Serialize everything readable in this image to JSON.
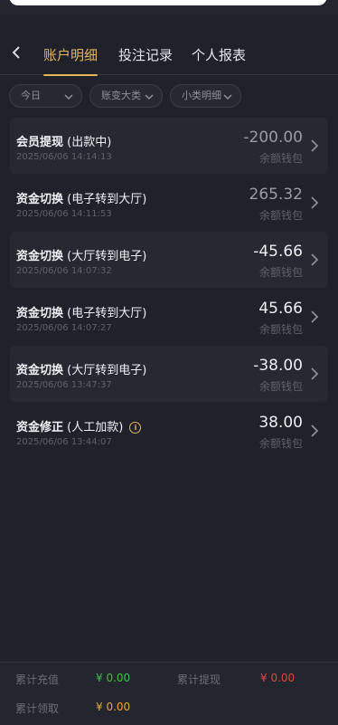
{
  "header": {
    "tabs": [
      {
        "label": "账户明细",
        "active": true
      },
      {
        "label": "投注记录",
        "active": false
      },
      {
        "label": "个人报表",
        "active": false
      }
    ]
  },
  "filters": [
    {
      "label": "今日"
    },
    {
      "label": "账变大类"
    },
    {
      "label": "小类明细"
    }
  ],
  "records": [
    {
      "title": "会员提现",
      "detail": "(出款中)",
      "time": "2025/06/06 14:14:13",
      "amount": "-200.00",
      "wallet": "余额钱包",
      "has_info": false
    },
    {
      "title": "资金切换",
      "detail": "(电子转到大厅)",
      "time": "2025/06/06 14:11:53",
      "amount": "265.32",
      "wallet": "余额钱包",
      "has_info": false
    },
    {
      "title": "资金切换",
      "detail": "(大厅转到电子)",
      "time": "2025/06/06 14:07:32",
      "amount": "-45.66",
      "wallet": "余额钱包",
      "has_info": false
    },
    {
      "title": "资金切换",
      "detail": "(电子转到大厅)",
      "time": "2025/06/06 14:07:27",
      "amount": "45.66",
      "wallet": "余额钱包",
      "has_info": false
    },
    {
      "title": "资金切换",
      "detail": "(大厅转到电子)",
      "time": "2025/06/06 13:47:37",
      "amount": "-38.00",
      "wallet": "余额钱包",
      "has_info": false
    },
    {
      "title": "资金修正",
      "detail": "(人工加款)",
      "time": "2025/06/06 13:44:07",
      "amount": "38.00",
      "wallet": "余额钱包",
      "has_info": true
    }
  ],
  "footer": {
    "recharge_label": "累计充值",
    "recharge_value": "¥ 0.00",
    "withdraw_label": "累计提现",
    "withdraw_value": "¥ 0.00",
    "claim_label": "累计领取",
    "claim_value": "¥ 0.00"
  },
  "colors": {
    "accent": "#e3b55b",
    "background": "#1f222b",
    "card": "#262931",
    "green": "#3fbf4b",
    "red": "#e0463f",
    "orange": "#e9a93a"
  }
}
